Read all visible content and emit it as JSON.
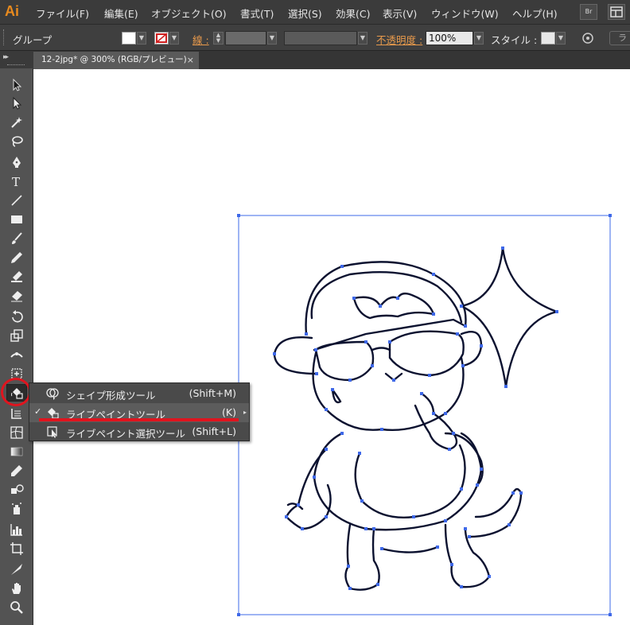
{
  "app": {
    "logo": "Ai"
  },
  "menu": {
    "items": [
      "ファイル(F)",
      "編集(E)",
      "オブジェクト(O)",
      "書式(T)",
      "選択(S)",
      "効果(C)",
      "表示(V)",
      "ウィンドウ(W)",
      "ヘルプ(H)"
    ],
    "bridge_label": "Br"
  },
  "control_bar": {
    "selection_label": "グループ",
    "stroke_label": "線 :",
    "opacity_label": "不透明度 :",
    "opacity_value": "100%",
    "style_label": "スタイル :",
    "truncated_right": "ラ"
  },
  "document": {
    "tab_title": "12-2jpg* @ 300% (RGB/プレビュー)",
    "close_glyph": "×"
  },
  "flyout": {
    "items": [
      {
        "label": "シェイプ形成ツール",
        "shortcut": "(Shift+M)",
        "selected": false
      },
      {
        "label": "ライブペイントツール",
        "shortcut": "(K)",
        "selected": true
      },
      {
        "label": "ライブペイント選択ツール",
        "shortcut": "(Shift+L)",
        "selected": false
      }
    ],
    "check_glyph": "✓",
    "submenu_glyph": "▸"
  },
  "tools": [
    "selection-tool",
    "direct-selection-tool",
    "magic-wand-tool",
    "lasso-tool",
    "pen-tool",
    "type-tool",
    "line-segment-tool",
    "rectangle-tool",
    "paintbrush-tool",
    "pencil-tool",
    "blob-brush-tool",
    "eraser-tool",
    "rotate-tool",
    "scale-tool",
    "width-tool",
    "free-transform-tool",
    "live-paint-bucket-tool",
    "perspective-grid-tool",
    "mesh-tool",
    "gradient-tool",
    "eyedropper-tool",
    "blend-tool",
    "symbol-sprayer-tool",
    "column-graph-tool",
    "artboard-tool",
    "slice-tool",
    "hand-tool",
    "zoom-tool"
  ],
  "colors": {
    "accent_orange": "#e89a4c",
    "anchor_blue": "#3e68e8",
    "highlight_red": "#e0141e"
  }
}
